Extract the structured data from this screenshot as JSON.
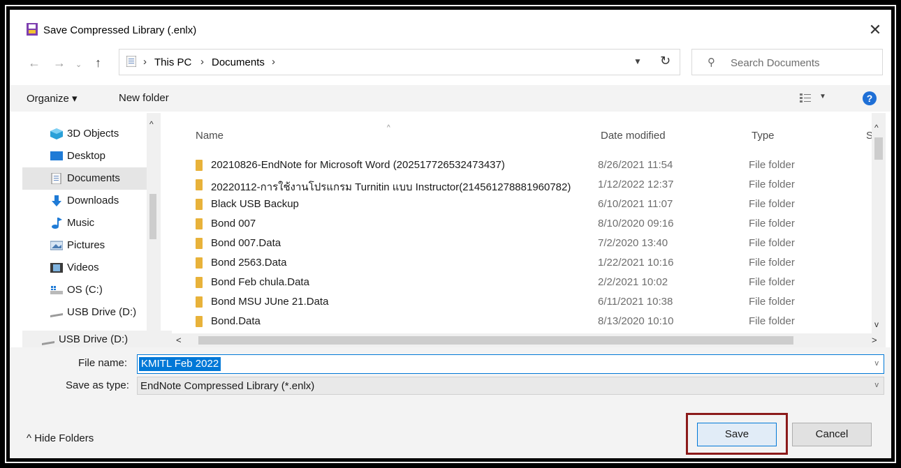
{
  "dialog": {
    "title": "Save Compressed Library (.enlx)",
    "close_glyph": "✕"
  },
  "address": {
    "crumbs": [
      "This PC",
      "Documents"
    ],
    "separator": "›"
  },
  "search": {
    "placeholder": "Search Documents"
  },
  "toolbar": {
    "organize_label": "Organize ▾",
    "new_folder_label": "New folder",
    "help_label": "?"
  },
  "nav_pane": {
    "items": [
      {
        "label": "3D Objects",
        "icon": "cube-icon"
      },
      {
        "label": "Desktop",
        "icon": "desktop-icon"
      },
      {
        "label": "Documents",
        "icon": "documents-icon",
        "selected": true
      },
      {
        "label": "Downloads",
        "icon": "download-icon"
      },
      {
        "label": "Music",
        "icon": "music-icon"
      },
      {
        "label": "Pictures",
        "icon": "pictures-icon"
      },
      {
        "label": "Videos",
        "icon": "videos-icon"
      },
      {
        "label": "OS (C:)",
        "icon": "drive-c-icon"
      },
      {
        "label": "USB Drive (D:)",
        "icon": "usb-drive-icon"
      },
      {
        "label": "USB Drive (D:)",
        "icon": "usb-drive-icon"
      }
    ]
  },
  "file_list": {
    "columns": {
      "name": "Name",
      "date": "Date modified",
      "type": "Type",
      "size": "S"
    },
    "rows": [
      {
        "name": "20210826-EndNote for Microsoft Word (202517726532473437)",
        "date": "8/26/2021 11:54",
        "type": "File folder"
      },
      {
        "name": "20220112-การใช้งานโปรแกรม Turnitin แบบ Instructor(214561278881960782)",
        "date": "1/12/2022 12:37",
        "type": "File folder"
      },
      {
        "name": "Black USB Backup",
        "date": "6/10/2021 11:07",
        "type": "File folder"
      },
      {
        "name": "Bond 007",
        "date": "8/10/2020 09:16",
        "type": "File folder"
      },
      {
        "name": "Bond 007.Data",
        "date": "7/2/2020 13:40",
        "type": "File folder"
      },
      {
        "name": "Bond 2563.Data",
        "date": "1/22/2021 10:16",
        "type": "File folder"
      },
      {
        "name": "Bond Feb chula.Data",
        "date": "2/2/2021 10:02",
        "type": "File folder"
      },
      {
        "name": "Bond MSU JUne 21.Data",
        "date": "6/11/2021 10:38",
        "type": "File folder"
      },
      {
        "name": "Bond.Data",
        "date": "8/13/2020 10:10",
        "type": "File folder"
      }
    ]
  },
  "save_form": {
    "file_name_label": "File name:",
    "file_name_value": "KMITL Feb 2022",
    "save_type_label": "Save as type:",
    "save_type_value": "EndNote Compressed Library (*.enlx)"
  },
  "footer": {
    "hide_folders_label": "Hide Folders",
    "save_label": "Save",
    "cancel_label": "Cancel",
    "highlight_color": "#8b1a1a"
  }
}
